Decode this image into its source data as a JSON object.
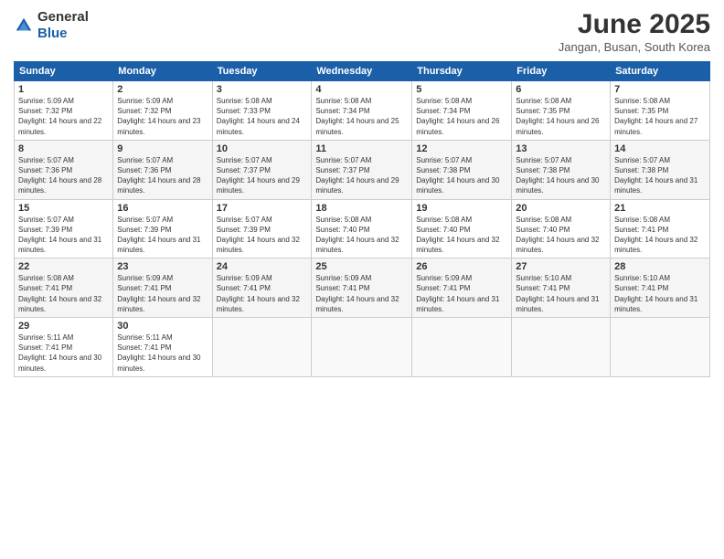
{
  "header": {
    "logo_general": "General",
    "logo_blue": "Blue",
    "month_year": "June 2025",
    "location": "Jangan, Busan, South Korea"
  },
  "weekdays": [
    "Sunday",
    "Monday",
    "Tuesday",
    "Wednesday",
    "Thursday",
    "Friday",
    "Saturday"
  ],
  "weeks": [
    [
      {
        "day": "1",
        "sunrise": "5:09 AM",
        "sunset": "7:32 PM",
        "daylight": "14 hours and 22 minutes."
      },
      {
        "day": "2",
        "sunrise": "5:09 AM",
        "sunset": "7:32 PM",
        "daylight": "14 hours and 23 minutes."
      },
      {
        "day": "3",
        "sunrise": "5:08 AM",
        "sunset": "7:33 PM",
        "daylight": "14 hours and 24 minutes."
      },
      {
        "day": "4",
        "sunrise": "5:08 AM",
        "sunset": "7:34 PM",
        "daylight": "14 hours and 25 minutes."
      },
      {
        "day": "5",
        "sunrise": "5:08 AM",
        "sunset": "7:34 PM",
        "daylight": "14 hours and 26 minutes."
      },
      {
        "day": "6",
        "sunrise": "5:08 AM",
        "sunset": "7:35 PM",
        "daylight": "14 hours and 26 minutes."
      },
      {
        "day": "7",
        "sunrise": "5:08 AM",
        "sunset": "7:35 PM",
        "daylight": "14 hours and 27 minutes."
      }
    ],
    [
      {
        "day": "8",
        "sunrise": "5:07 AM",
        "sunset": "7:36 PM",
        "daylight": "14 hours and 28 minutes."
      },
      {
        "day": "9",
        "sunrise": "5:07 AM",
        "sunset": "7:36 PM",
        "daylight": "14 hours and 28 minutes."
      },
      {
        "day": "10",
        "sunrise": "5:07 AM",
        "sunset": "7:37 PM",
        "daylight": "14 hours and 29 minutes."
      },
      {
        "day": "11",
        "sunrise": "5:07 AM",
        "sunset": "7:37 PM",
        "daylight": "14 hours and 29 minutes."
      },
      {
        "day": "12",
        "sunrise": "5:07 AM",
        "sunset": "7:38 PM",
        "daylight": "14 hours and 30 minutes."
      },
      {
        "day": "13",
        "sunrise": "5:07 AM",
        "sunset": "7:38 PM",
        "daylight": "14 hours and 30 minutes."
      },
      {
        "day": "14",
        "sunrise": "5:07 AM",
        "sunset": "7:38 PM",
        "daylight": "14 hours and 31 minutes."
      }
    ],
    [
      {
        "day": "15",
        "sunrise": "5:07 AM",
        "sunset": "7:39 PM",
        "daylight": "14 hours and 31 minutes."
      },
      {
        "day": "16",
        "sunrise": "5:07 AM",
        "sunset": "7:39 PM",
        "daylight": "14 hours and 31 minutes."
      },
      {
        "day": "17",
        "sunrise": "5:07 AM",
        "sunset": "7:39 PM",
        "daylight": "14 hours and 32 minutes."
      },
      {
        "day": "18",
        "sunrise": "5:08 AM",
        "sunset": "7:40 PM",
        "daylight": "14 hours and 32 minutes."
      },
      {
        "day": "19",
        "sunrise": "5:08 AM",
        "sunset": "7:40 PM",
        "daylight": "14 hours and 32 minutes."
      },
      {
        "day": "20",
        "sunrise": "5:08 AM",
        "sunset": "7:40 PM",
        "daylight": "14 hours and 32 minutes."
      },
      {
        "day": "21",
        "sunrise": "5:08 AM",
        "sunset": "7:41 PM",
        "daylight": "14 hours and 32 minutes."
      }
    ],
    [
      {
        "day": "22",
        "sunrise": "5:08 AM",
        "sunset": "7:41 PM",
        "daylight": "14 hours and 32 minutes."
      },
      {
        "day": "23",
        "sunrise": "5:09 AM",
        "sunset": "7:41 PM",
        "daylight": "14 hours and 32 minutes."
      },
      {
        "day": "24",
        "sunrise": "5:09 AM",
        "sunset": "7:41 PM",
        "daylight": "14 hours and 32 minutes."
      },
      {
        "day": "25",
        "sunrise": "5:09 AM",
        "sunset": "7:41 PM",
        "daylight": "14 hours and 32 minutes."
      },
      {
        "day": "26",
        "sunrise": "5:09 AM",
        "sunset": "7:41 PM",
        "daylight": "14 hours and 31 minutes."
      },
      {
        "day": "27",
        "sunrise": "5:10 AM",
        "sunset": "7:41 PM",
        "daylight": "14 hours and 31 minutes."
      },
      {
        "day": "28",
        "sunrise": "5:10 AM",
        "sunset": "7:41 PM",
        "daylight": "14 hours and 31 minutes."
      }
    ],
    [
      {
        "day": "29",
        "sunrise": "5:11 AM",
        "sunset": "7:41 PM",
        "daylight": "14 hours and 30 minutes."
      },
      {
        "day": "30",
        "sunrise": "5:11 AM",
        "sunset": "7:41 PM",
        "daylight": "14 hours and 30 minutes."
      },
      null,
      null,
      null,
      null,
      null
    ]
  ]
}
